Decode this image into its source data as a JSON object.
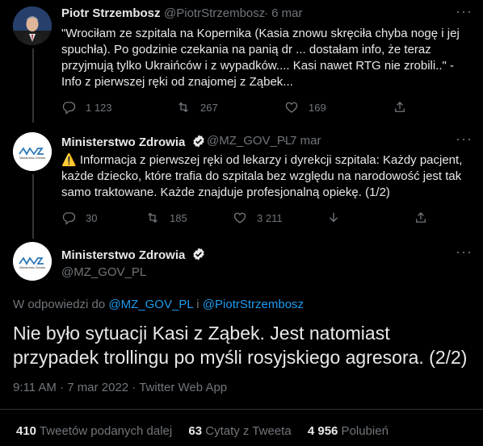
{
  "tweet1": {
    "name": "Piotr Strzembosz",
    "handle": "@PiotrStrzembosz",
    "date": "· 6 mar",
    "lines": [
      "\"Wrociłam ze szpitala na Kopernika (Kasia znowu skręciła chyba nogę i jej",
      "spuchła). Po godzinie czekania na panią dr ... dostałam info, że teraz",
      "przyjmują tylko Ukraińców i z wypadków.... Kasi nawet RTG nie zrobili..\" -",
      "Info z pierwszej ręki od znajomej z Ząbek..."
    ],
    "reply_count": "1 123",
    "retweet_count": "267",
    "like_count": "169"
  },
  "tweet2": {
    "name": "Ministerstwo Zdrowia",
    "handle": "@MZ_GOV_PL",
    "date": "· 7 mar",
    "lines": [
      "⚠️ Informacja z pierwszej ręki od lekarzy i dyrekcji szpitala: Każdy pacjent,",
      "każde dziecko, które trafia do szpitala bez względu na narodowość jest tak",
      "samo traktowane. Każde znajduje profesjonalną opiekę. (1/2)"
    ],
    "reply_count": "30",
    "retweet_count": "185",
    "like_count": "3 211"
  },
  "main": {
    "name": "Ministerstwo Zdrowia",
    "handle": "@MZ_GOV_PL",
    "reply_prefix": "W odpowiedzi do ",
    "mention1": "@MZ_GOV_PL",
    "reply_and": " i ",
    "mention2": "@PiotrStrzembosz",
    "text_line1": "Nie było sytuacji Kasi z Ząbek. Jest natomiast",
    "text_line2": "przypadek trollingu po myśli rosyjskiego agresora. (2/2)",
    "meta": "9:11 AM · 7 mar 2022 · Twitter Web App",
    "retweets_num": "410",
    "retweets_label": " Tweetów podanych dalej",
    "quotes_num": "63",
    "quotes_label": " Cytaty z Tweeta",
    "likes_num": "4 956",
    "likes_label": " Polubień"
  },
  "logo": {
    "text": "Ministerstwo Zdrowia"
  },
  "more_label": "···",
  "colors": {
    "accent": "#1d9bf0",
    "verified": "#e7e9ea",
    "logo_blue": "#2e78b7"
  }
}
